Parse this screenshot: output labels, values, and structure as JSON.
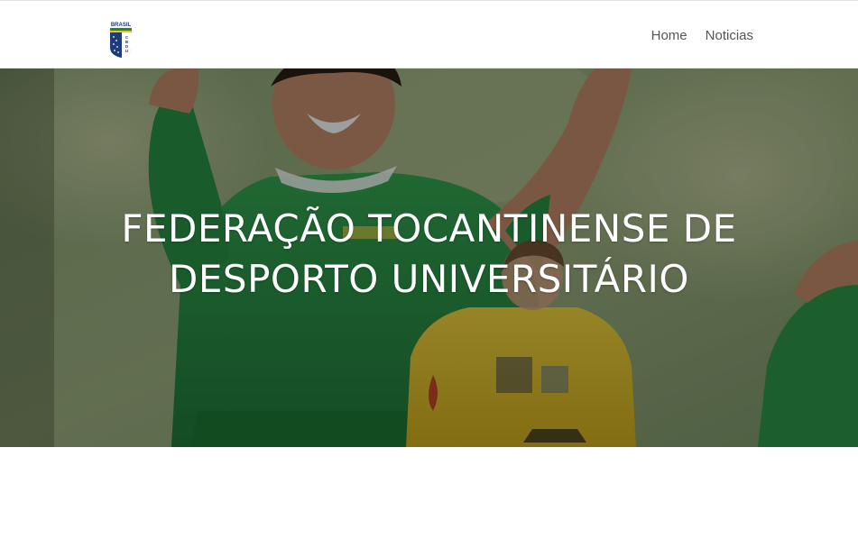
{
  "header": {
    "logo": {
      "text": "BRASIL",
      "icon": "cbdu-shield-logo",
      "colors": {
        "blue": "#1f3b7a",
        "green": "#1a8a3a",
        "yellow": "#f1c40f"
      }
    },
    "nav": {
      "items": [
        {
          "label": "Home"
        },
        {
          "label": "Noticias"
        }
      ]
    }
  },
  "hero": {
    "title_line1": "FEDERAÇÃO TOCANTINENSE DE",
    "title_line2": "DESPORTO UNIVERSITÁRIO",
    "image": "athletes-celebrating-photo",
    "colors": {
      "jersey_green": "#2e9a48",
      "jersey_yellow": "#e8c52a",
      "background_green": "#7fa06a"
    }
  }
}
